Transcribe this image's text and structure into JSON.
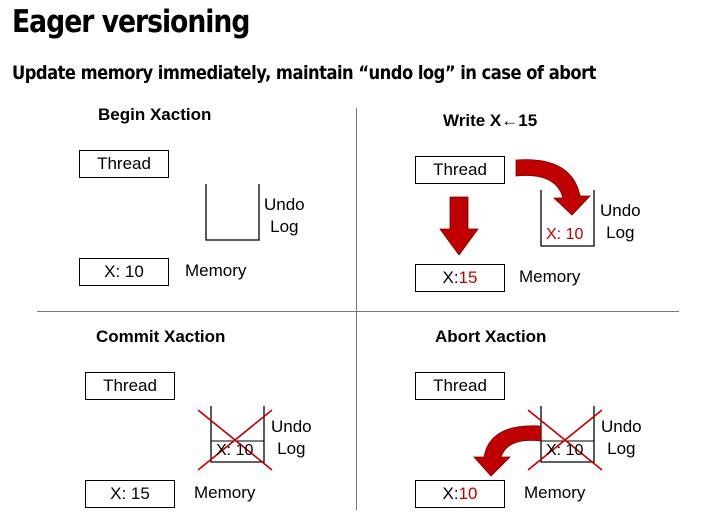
{
  "title": "Eager versioning",
  "subtitle": "Update memory immediately, maintain “undo log” in case of abort",
  "colors": {
    "highlight": "#c00000",
    "divider": "#777777"
  },
  "panels": {
    "begin": {
      "heading": "Begin Xaction",
      "thread": "Thread",
      "memory_value": "X: 10",
      "memory_label": "Memory",
      "undo_label_line1": "Undo",
      "undo_label_line2": "Log"
    },
    "write": {
      "heading": "Write X←15",
      "thread": "Thread",
      "memory_prefix": "X: ",
      "memory_new": "15",
      "memory_label": "Memory",
      "undo_prefix": "X: ",
      "undo_value": "10",
      "undo_label_line1": "Undo",
      "undo_label_line2": "Log"
    },
    "commit": {
      "heading": "Commit Xaction",
      "thread": "Thread",
      "memory_value": "X: 15",
      "memory_label": "Memory",
      "undo_entry": "X: 10",
      "undo_label_line1": "Undo",
      "undo_label_line2": "Log"
    },
    "abort": {
      "heading": "Abort Xaction",
      "thread": "Thread",
      "memory_prefix": "X: ",
      "memory_restored": "10",
      "memory_label": "Memory",
      "undo_entry": "X: 10",
      "undo_label_line1": "Undo",
      "undo_label_line2": "Log"
    }
  }
}
